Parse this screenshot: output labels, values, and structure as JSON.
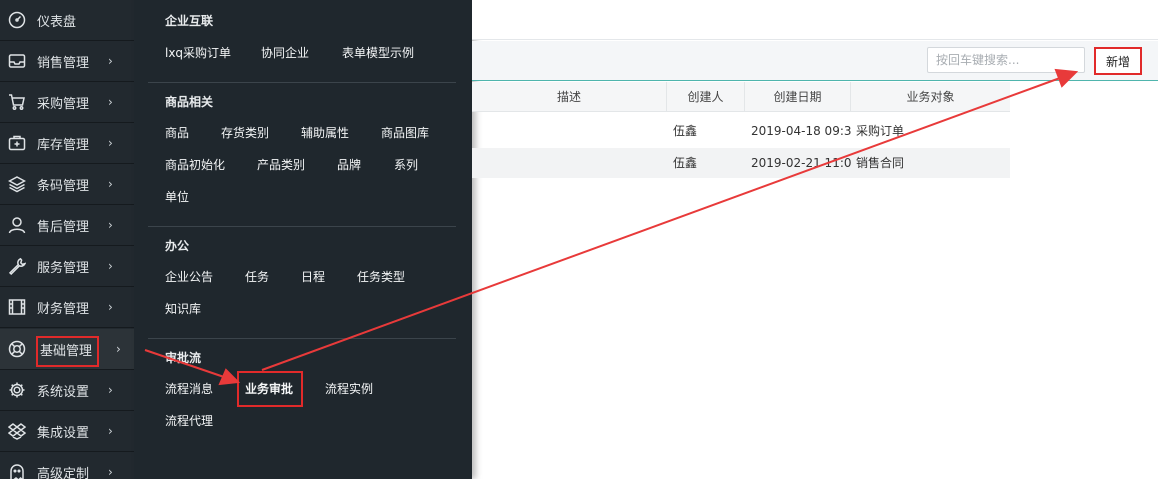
{
  "sidebar": {
    "items": [
      {
        "label": "仪表盘",
        "icon": "dashboard-icon",
        "has_chevron": false
      },
      {
        "label": "销售管理",
        "icon": "inbox-icon",
        "has_chevron": true
      },
      {
        "label": "采购管理",
        "icon": "cart-icon",
        "has_chevron": true
      },
      {
        "label": "库存管理",
        "icon": "medkit-icon",
        "has_chevron": true
      },
      {
        "label": "条码管理",
        "icon": "layers-icon",
        "has_chevron": true
      },
      {
        "label": "售后管理",
        "icon": "user-icon",
        "has_chevron": true
      },
      {
        "label": "服务管理",
        "icon": "wrench-icon",
        "has_chevron": true
      },
      {
        "label": "财务管理",
        "icon": "film-icon",
        "has_chevron": true
      },
      {
        "label": "基础管理",
        "icon": "lifebuoy-icon",
        "has_chevron": true,
        "active": true
      },
      {
        "label": "系统设置",
        "icon": "gear-icon",
        "has_chevron": true
      },
      {
        "label": "集成设置",
        "icon": "dropbox-icon",
        "has_chevron": true
      },
      {
        "label": "高级定制",
        "icon": "ghost-icon",
        "has_chevron": true
      }
    ],
    "chevron": "›"
  },
  "megamenu": {
    "sections": [
      {
        "title": "企业互联",
        "links": [
          "lxq采购订单",
          "协同企业",
          "表单模型示例"
        ]
      },
      {
        "title": "商品相关",
        "links": [
          "商品",
          "存货类别",
          "辅助属性",
          "商品图库",
          "商品初始化",
          "产品类别",
          "品牌",
          "系列",
          "单位"
        ]
      },
      {
        "title": "办公",
        "links": [
          "企业公告",
          "任务",
          "日程",
          "任务类型",
          "知识库"
        ]
      },
      {
        "title": "审批流",
        "links": [
          "流程消息",
          "业务审批",
          "流程实例",
          "流程代理"
        ]
      }
    ]
  },
  "toolbar": {
    "search_placeholder": "按回车键搜索...",
    "new_button": "新增"
  },
  "table": {
    "columns": [
      "描述",
      "创建人",
      "创建日期",
      "业务对象"
    ],
    "rows": [
      {
        "desc": "",
        "creator": "伍鑫",
        "date": "2019-04-18 09:3...",
        "object": "采购订单"
      },
      {
        "desc": "",
        "creator": "伍鑫",
        "date": "2019-02-21 11:0...",
        "object": "销售合同"
      }
    ]
  },
  "colors": {
    "sidebar_bg": "#22292f",
    "menu_bg": "#1f272d",
    "highlight": "#e12a2a",
    "accent": "#4fb5ad"
  }
}
